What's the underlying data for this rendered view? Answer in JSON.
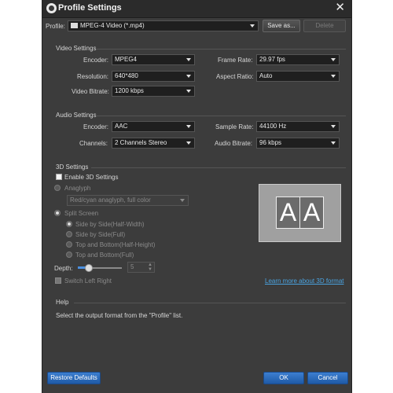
{
  "window": {
    "title": "Profile Settings",
    "close_glyph": "✕"
  },
  "profile": {
    "label": "Profile:",
    "value": "MPEG-4 Video (*.mp4)",
    "save_as": "Save as...",
    "delete": "Delete"
  },
  "video": {
    "section": "Video Settings",
    "encoder_label": "Encoder:",
    "encoder": "MPEG4",
    "resolution_label": "Resolution:",
    "resolution": "640*480",
    "bitrate_label": "Video Bitrate:",
    "bitrate": "1200 kbps",
    "framerate_label": "Frame Rate:",
    "framerate": "29.97 fps",
    "aspect_label": "Aspect Ratio:",
    "aspect": "Auto"
  },
  "audio": {
    "section": "Audio Settings",
    "encoder_label": "Encoder:",
    "encoder": "AAC",
    "channels_label": "Channels:",
    "channels": "2 Channels Stereo",
    "samplerate_label": "Sample Rate:",
    "samplerate": "44100 Hz",
    "bitrate_label": "Audio Bitrate:",
    "bitrate": "96 kbps"
  },
  "three_d": {
    "section": "3D Settings",
    "enable": "Enable 3D Settings",
    "anaglyph": "Anaglyph",
    "anaglyph_option": "Red/cyan anaglyph, full color",
    "split_screen": "Split Screen",
    "sbs_half": "Side by Side(Half-Width)",
    "sbs_full": "Side by Side(Full)",
    "tb_half": "Top and Bottom(Half-Height)",
    "tb_full": "Top and Bottom(Full)",
    "depth_label": "Depth:",
    "depth_value": "5",
    "switch_lr": "Switch Left Right",
    "preview_left": "A",
    "preview_right": "A",
    "learn_more": "Learn more about 3D format"
  },
  "help": {
    "section": "Help",
    "text": "Select the output format from the \"Profile\" list."
  },
  "footer": {
    "restore": "Restore Defaults",
    "ok": "OK",
    "cancel": "Cancel"
  }
}
